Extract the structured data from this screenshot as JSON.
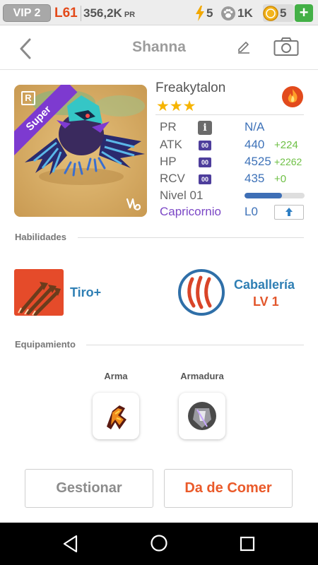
{
  "topbar": {
    "vip": "VIP 2",
    "level": "L61",
    "pr_value": "356,2K",
    "pr_unit": "PR",
    "energy": "5",
    "paws": "1K",
    "coins": "5",
    "add_label": "+"
  },
  "header": {
    "title": "Shanna"
  },
  "pet": {
    "rarity_badge": "R",
    "ribbon": "Super",
    "name": "Freakytalon",
    "stars": "★★★",
    "element_icon": "fire-icon",
    "stats": {
      "pr_label": "PR",
      "pr_value": "N/A",
      "atk_label": "ATK",
      "atk_tag": "00",
      "atk_value": "440",
      "atk_bonus": "+224",
      "hp_label": "HP",
      "hp_tag": "00",
      "hp_value": "4525",
      "hp_bonus": "+2262",
      "rcv_label": "RCV",
      "rcv_tag": "00",
      "rcv_value": "435",
      "rcv_bonus": "+0",
      "level_label": "Nivel 01",
      "level_progress": 0.62,
      "zodiac_label": "Capricornio",
      "zodiac_level": "L0"
    }
  },
  "skills": {
    "title": "Habilidades",
    "items": [
      {
        "name": "Tiro+",
        "icon": "arrows-icon"
      },
      {
        "name": "Caballería",
        "level": "LV 1",
        "icon": "claw-icon"
      }
    ]
  },
  "equipment": {
    "title": "Equipamiento",
    "weapon_label": "Arma",
    "armor_label": "Armadura"
  },
  "actions": {
    "manage": "Gestionar",
    "feed": "Da de Comer"
  },
  "colors": {
    "accent_blue": "#3e72b8",
    "bonus_green": "#6ec045",
    "feed_orange": "#ea5a2a",
    "zodiac_purple": "#7b47c6"
  }
}
